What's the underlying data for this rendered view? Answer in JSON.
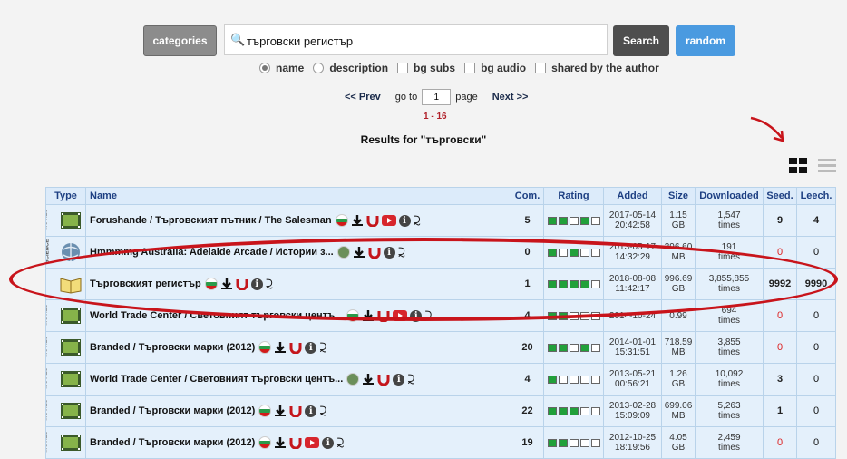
{
  "search": {
    "categories_label": "categories",
    "query": "търговски регистър",
    "search_label": "Search",
    "random_label": "random",
    "options": [
      {
        "label": "name",
        "type": "radio",
        "checked": true
      },
      {
        "label": "description",
        "type": "radio",
        "checked": false
      },
      {
        "label": "bg subs",
        "type": "checkbox",
        "checked": false
      },
      {
        "label": "bg audio",
        "type": "checkbox",
        "checked": false
      },
      {
        "label": "shared by the author",
        "type": "checkbox",
        "checked": false
      }
    ]
  },
  "pager": {
    "prev_label": "<< Prev",
    "goto_label": "go to",
    "page_value": "1",
    "page_label": "page",
    "next_label": "Next >>",
    "range": "1 - 16"
  },
  "results_title": "Results for \"търговски\"",
  "table": {
    "headers": {
      "type": "Type",
      "name": "Name",
      "comments": "Com.",
      "rating": "Rating",
      "added": "Added",
      "size": "Size",
      "downloaded": "Downloaded",
      "seed": "Seed.",
      "leech": "Leech."
    },
    "rows": [
      {
        "category": "MOVIES",
        "name": "Forushande / Търговският пътник / The Salesman",
        "flag": true,
        "yt": true,
        "comments": "5",
        "rating": [
          1,
          1,
          0,
          1,
          0
        ],
        "added_date": "2017-05-14",
        "added_time": "20:42:58",
        "size_value": "1.15",
        "size_unit": "GB",
        "downloaded": "1,547",
        "times": "times",
        "seed": "9",
        "leech": "4"
      },
      {
        "category": "SCIENCE",
        "name": "Hmmmmg Australia: Adelaide Arcade / Истории з...",
        "flag": false,
        "yt": false,
        "comments": "0",
        "rating": [
          1,
          0,
          1,
          0,
          0
        ],
        "added_date": "2013-05-17",
        "added_time": "14:32:29",
        "size_value": "396.60",
        "size_unit": "MB",
        "downloaded": "191",
        "times": "times",
        "seed": "0",
        "leech": "0"
      },
      {
        "category": "BOOKS",
        "name": "Търговският  регистър",
        "flag": true,
        "yt": false,
        "comments": "1",
        "rating": [
          1,
          1,
          1,
          1,
          0
        ],
        "added_date": "2018-08-08",
        "added_time": "11:42:17",
        "size_value": "996.69",
        "size_unit": "GB",
        "downloaded": "3,855,855",
        "times": "times",
        "seed": "9992",
        "leech": "9990"
      },
      {
        "category": "MOVIES",
        "name": "World Trade Center / Световният търговски центъ...",
        "flag": true,
        "yt": true,
        "comments": "4",
        "rating": [
          1,
          1,
          0,
          0,
          0
        ],
        "added_date": "2014-10-24",
        "added_time": "",
        "size_value": "0.99",
        "size_unit": "",
        "downloaded": "694",
        "times": "times",
        "seed": "0",
        "leech": "0"
      },
      {
        "category": "MOVIES",
        "name": "Branded / Търговски марки (2012)",
        "flag": true,
        "yt": false,
        "comments": "20",
        "rating": [
          1,
          1,
          0,
          1,
          0
        ],
        "added_date": "2014-01-01",
        "added_time": "15:31:51",
        "size_value": "718.59",
        "size_unit": "MB",
        "downloaded": "3,855",
        "times": "times",
        "seed": "0",
        "leech": "0"
      },
      {
        "category": "MOVIES",
        "name": "World Trade Center / Световният търговски центъ...",
        "flag": false,
        "yt": false,
        "comments": "4",
        "rating": [
          1,
          0,
          0,
          0,
          0
        ],
        "added_date": "2013-05-21",
        "added_time": "00:56:21",
        "size_value": "1.26",
        "size_unit": "GB",
        "downloaded": "10,092",
        "times": "times",
        "seed": "3",
        "leech": "0"
      },
      {
        "category": "MOVIES",
        "name": "Branded / Търговски марки (2012)",
        "flag": true,
        "yt": false,
        "comments": "22",
        "rating": [
          1,
          1,
          1,
          0,
          0
        ],
        "added_date": "2013-02-28",
        "added_time": "15:09:09",
        "size_value": "699.06",
        "size_unit": "MB",
        "downloaded": "5,263",
        "times": "times",
        "seed": "1",
        "leech": "0"
      },
      {
        "category": "MOVIES",
        "name": "Branded / Търговски марки (2012)",
        "flag": true,
        "yt": true,
        "comments": "19",
        "rating": [
          1,
          1,
          0,
          0,
          0
        ],
        "added_date": "2012-10-25",
        "added_time": "18:19:56",
        "size_value": "4.05",
        "size_unit": "GB",
        "downloaded": "2,459",
        "times": "times",
        "seed": "0",
        "leech": "0"
      }
    ]
  },
  "colors": {
    "accent": "#4a9ae0",
    "header_bg": "#dcebfa",
    "row_bg": "#e4f0fb",
    "annotation": "#c8141b"
  },
  "icons": [
    "search-icon",
    "flag-bg-icon",
    "download-icon",
    "magnet-icon",
    "youtube-icon",
    "info-icon",
    "share-icon",
    "grid-view-icon",
    "list-view-icon"
  ]
}
